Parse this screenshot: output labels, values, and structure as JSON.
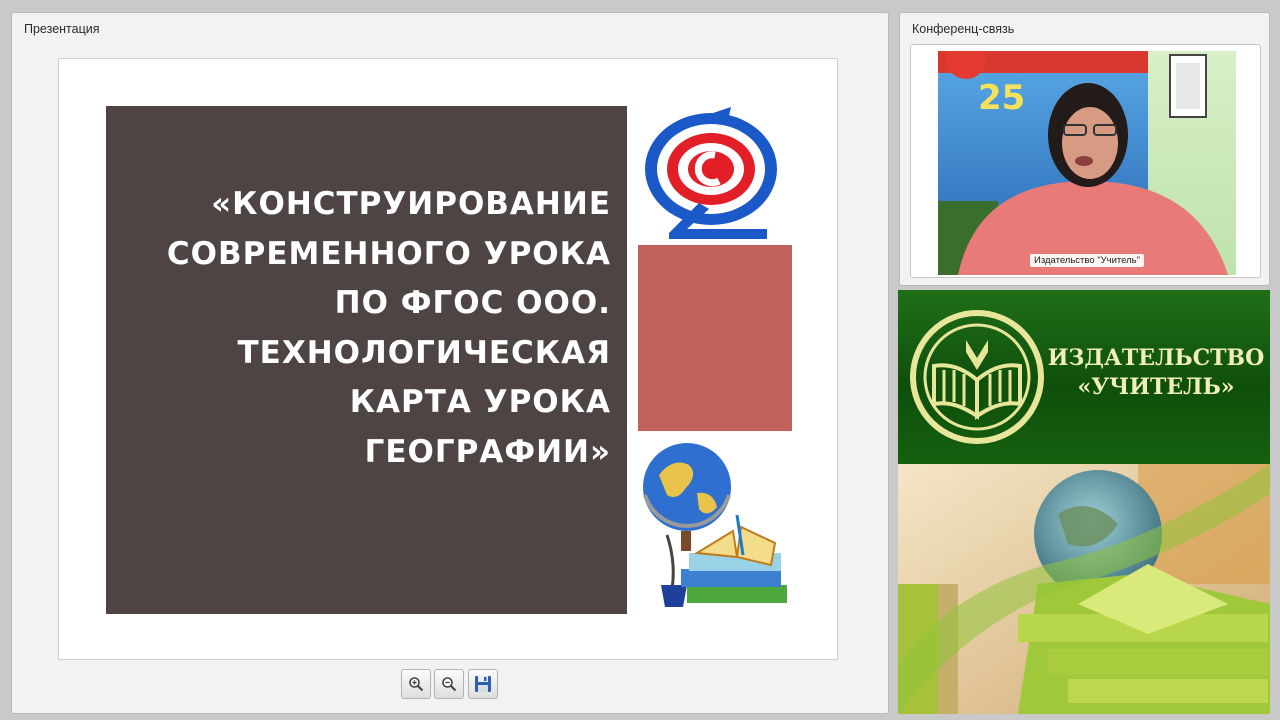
{
  "presentation": {
    "title": "Презентация",
    "slide": {
      "title_lines": [
        "«КОНСТРУИРОВАНИЕ",
        "СОВРЕМЕННОГО УРОКА",
        "ПО ФГОС ООО.",
        "ТЕХНОЛОГИЧЕСКАЯ",
        "КАРТА УРОКА",
        "ГЕОГРАФИИ»"
      ],
      "title_box_color": "#4d4443",
      "accent_square_color": "#c0615a",
      "logo_icon": "publisher-logo-icon",
      "illustration_icon": "globe-books-icon"
    },
    "toolbar": {
      "zoom_in_icon": "zoom-in-icon",
      "zoom_out_icon": "zoom-out-icon",
      "save_icon": "save-icon"
    }
  },
  "conference": {
    "title": "Конференц-связь",
    "video_caption": "Издательство \"Учитель\"",
    "poster_text": "25"
  },
  "banner": {
    "line1": "ИЗДАТЕЛЬСТВО",
    "line2": "«УЧИТЕЛЬ»",
    "background_color": "#15600f",
    "text_color": "#f1efb8",
    "emblem_icon": "publisher-emblem-icon"
  }
}
